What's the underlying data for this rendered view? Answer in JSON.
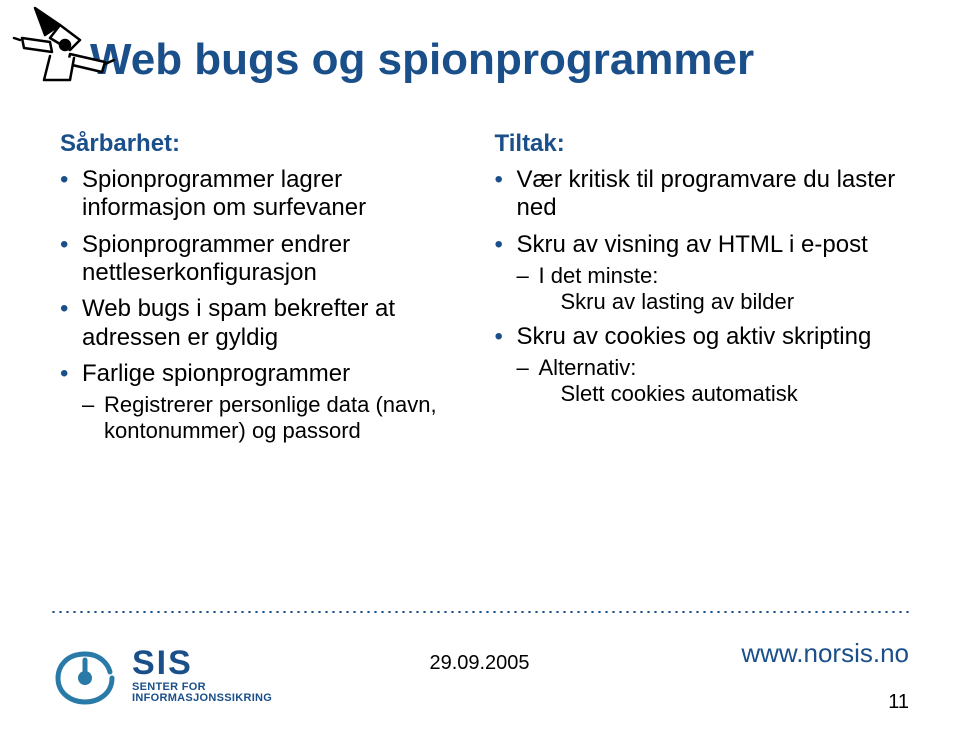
{
  "title": "Web bugs og spionprogrammer",
  "left": {
    "heading": "Sårbarhet:",
    "b1": "Spionprogrammer lagrer informasjon om surfevaner",
    "b2": "Spionprogrammer endrer nettleserkonfigurasjon",
    "b3": "Web bugs i spam bekrefter at adressen er gyldig",
    "b4": "Farlige spionprogrammer",
    "b4_sub": "Registrerer personlige data (navn, kontonummer) og passord"
  },
  "right": {
    "heading": "Tiltak:",
    "b1": "Vær kritisk til programvare du laster ned",
    "b2": "Skru av visning av HTML i e-post",
    "b2_sub": "I det minste:",
    "b2_subsub": "Skru av lasting av bilder",
    "b3": "Skru av cookies og aktiv skripting",
    "b3_sub": "Alternativ:",
    "b3_subsub": "Slett cookies automatisk"
  },
  "footer": {
    "logo_big": "SIS",
    "logo_small1": "SENTER FOR",
    "logo_small2": "INFORMASJONSSIKRING",
    "date": "29.09.2005",
    "url": "www.norsis.no",
    "page": "11"
  }
}
